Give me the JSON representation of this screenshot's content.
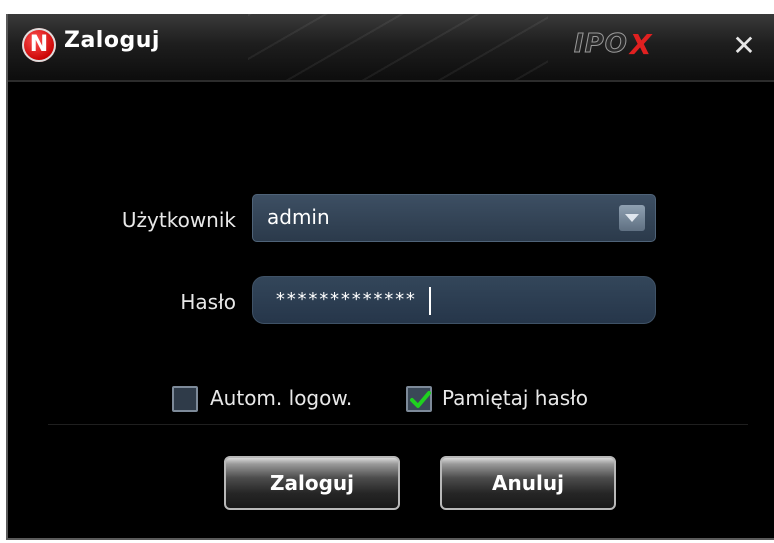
{
  "window": {
    "title": "Zaloguj",
    "logo_letter": "N",
    "brand": "IPO",
    "brand_x": "X",
    "close_glyph": "✕"
  },
  "form": {
    "user_label": "Użytkownik",
    "user_value": "admin",
    "password_label": "Hasło",
    "password_value": "*************",
    "auto_login_label": "Autom. logow.",
    "auto_login_checked": false,
    "remember_label": "Pamiętaj hasło",
    "remember_checked": true
  },
  "buttons": {
    "login": "Zaloguj",
    "cancel": "Anuluj"
  },
  "icons": {
    "app_logo": "app-logo-icon",
    "close": "close-icon",
    "dropdown": "chevron-down-icon",
    "check": "checkmark-icon"
  },
  "colors": {
    "check_green": "#1fd11f",
    "brand_red": "#e02020",
    "logo_red": "#c80000"
  }
}
